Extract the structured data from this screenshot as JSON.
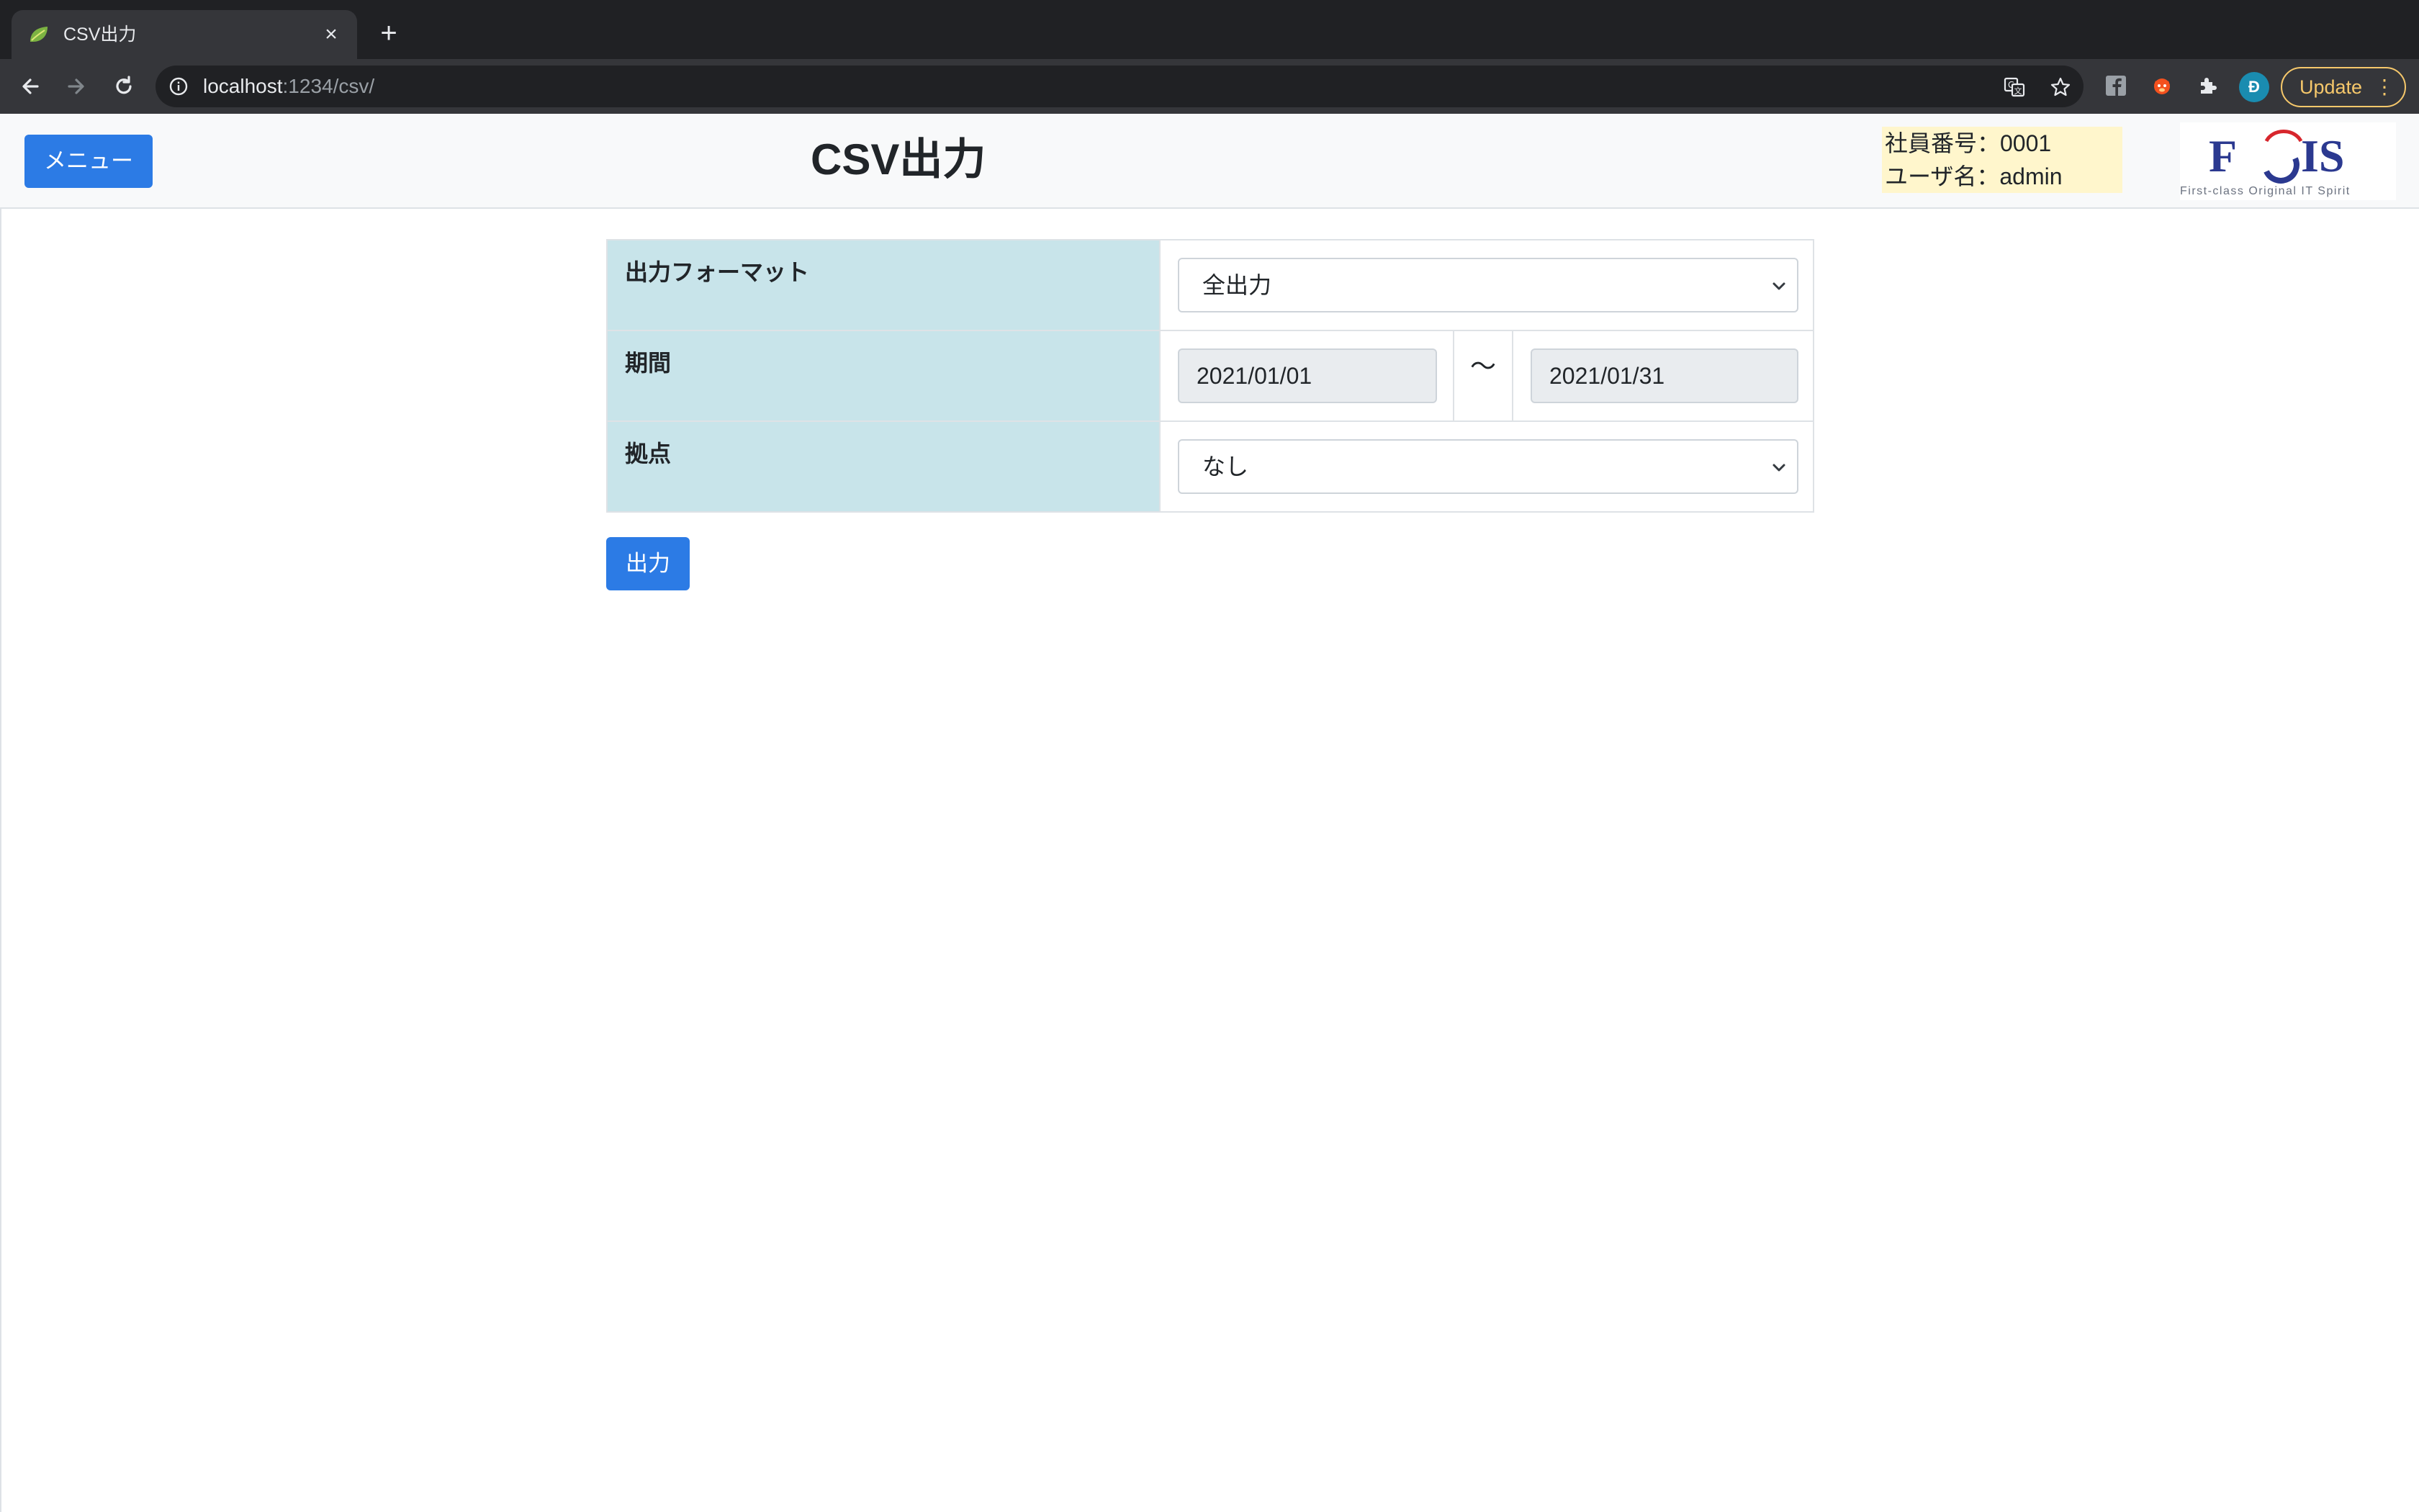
{
  "browser": {
    "tab_title": "CSV出力",
    "url_host": "localhost",
    "url_path": ":1234/csv/",
    "update_label": "Update",
    "profile_initial": "Đ"
  },
  "header": {
    "menu_label": "メニュー",
    "title": "CSV出力",
    "employee_no": "社員番号：0001",
    "user_name": "ユーザ名：admin",
    "logo_text": "FOIS",
    "logo_tagline": "First-class Original IT Spirit"
  },
  "form": {
    "format_label": "出力フォーマット",
    "format_value": "全出力",
    "period_label": "期間",
    "period_from": "2021/01/01",
    "period_separator": "〜",
    "period_to": "2021/01/31",
    "branch_label": "拠点",
    "branch_value": "なし"
  },
  "actions": {
    "output_label": "出力"
  },
  "colors": {
    "primary": "#2c7be5",
    "label_bg": "#c8e4ea",
    "user_box_bg": "#fff6cc",
    "logo_blue": "#2b3990",
    "logo_red": "#d7262d"
  }
}
